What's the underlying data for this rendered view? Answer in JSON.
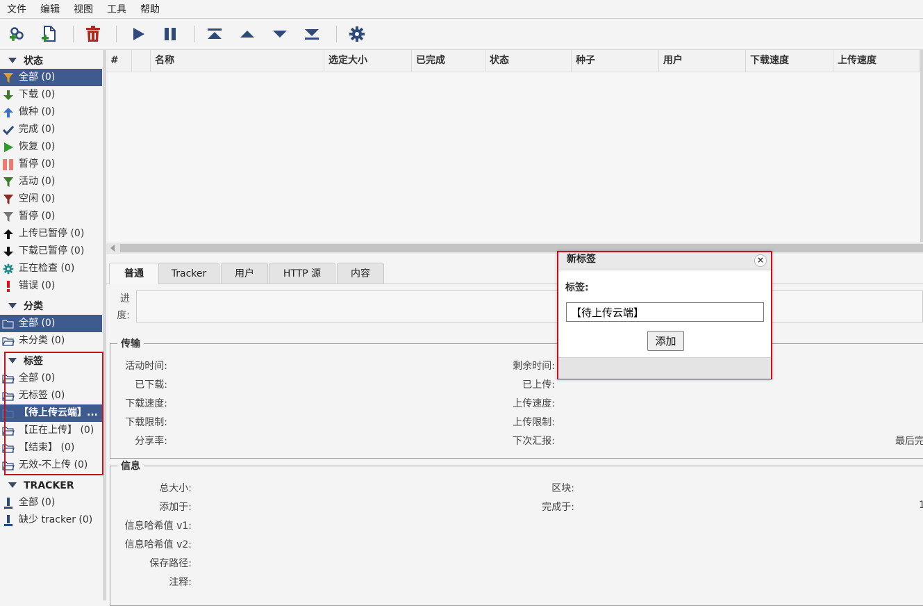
{
  "menu": [
    "文件",
    "编辑",
    "视图",
    "工具",
    "帮助"
  ],
  "toolbar": {
    "add_link": "add-link-icon",
    "add_file": "add-file-icon",
    "delete": "delete-icon",
    "start": "play-icon",
    "pause": "pause-icon",
    "top": "move-top-icon",
    "up": "move-up-icon",
    "down": "move-down-icon",
    "bottom": "move-bottom-icon",
    "options": "gear-icon"
  },
  "sidebar": {
    "status_title": "状态",
    "status": [
      {
        "label": "全部 (0)",
        "icon": "filter-icon",
        "selected": true
      },
      {
        "label": "下载 (0)",
        "icon": "download-arrow-icon"
      },
      {
        "label": "做种 (0)",
        "icon": "upload-arrow-icon"
      },
      {
        "label": "完成 (0)",
        "icon": "checkmark-icon"
      },
      {
        "label": "恢复 (0)",
        "icon": "play-icon"
      },
      {
        "label": "暂停 (0)",
        "icon": "pause-icon"
      },
      {
        "label": "活动 (0)",
        "icon": "filter-icon"
      },
      {
        "label": "空闲 (0)",
        "icon": "filter-icon"
      },
      {
        "label": "暂停 (0)",
        "icon": "filter-icon"
      },
      {
        "label": "上传已暂停 (0)",
        "icon": "up-arrow-icon"
      },
      {
        "label": "下载已暂停 (0)",
        "icon": "down-arrow-icon"
      },
      {
        "label": "正在检查 (0)",
        "icon": "gear-icon"
      },
      {
        "label": "错误 (0)",
        "icon": "exclamation-icon"
      }
    ],
    "categories_title": "分类",
    "categories": [
      {
        "label": "全部 (0)",
        "selected": true
      },
      {
        "label": "未分类 (0)"
      }
    ],
    "tags_title": "标签",
    "tags": [
      {
        "label": "全部 (0)"
      },
      {
        "label": "无标签 (0)"
      },
      {
        "label": "【待上传云端】...",
        "selected": true
      },
      {
        "label": "【正在上传】 (0)"
      },
      {
        "label": "【结束】 (0)"
      },
      {
        "label": "无效-不上传 (0)"
      }
    ],
    "trackers_title": "TRACKER",
    "trackers": [
      {
        "label": "全部 (0)"
      },
      {
        "label": "缺少 tracker (0)"
      }
    ]
  },
  "table": {
    "columns": [
      "#",
      "",
      "名称",
      "选定大小",
      "已完成",
      "状态",
      "种子",
      "用户",
      "下载速度",
      "上传速度"
    ]
  },
  "details": {
    "tabs": [
      "普通",
      "Tracker",
      "用户",
      "HTTP 源",
      "内容"
    ],
    "progress_label": "进度:",
    "transfer_title": "传输",
    "transfer_left": [
      "活动时间:",
      "已下载:",
      "下载速度:",
      "下载限制:",
      "分享率:"
    ],
    "transfer_right": [
      "剩余时间:",
      "已上传:",
      "上传速度:",
      "上传限制:",
      "下次汇报:"
    ],
    "transfer_far": "最后完",
    "info_title": "信息",
    "info_left": [
      "总大小:",
      "添加于:",
      "信息哈希值 v1:",
      "信息哈希值 v2:",
      "保存路径:",
      "注释:"
    ],
    "info_right": [
      "区块:",
      "完成于:"
    ],
    "info_far": "1"
  },
  "dialog": {
    "title": "新标签",
    "close": "×",
    "label": "标签:",
    "value": "【待上传云端】",
    "button": "添加"
  },
  "colors": {
    "selection": "#3e5a8f",
    "highlight_frame": "#c8101c"
  }
}
